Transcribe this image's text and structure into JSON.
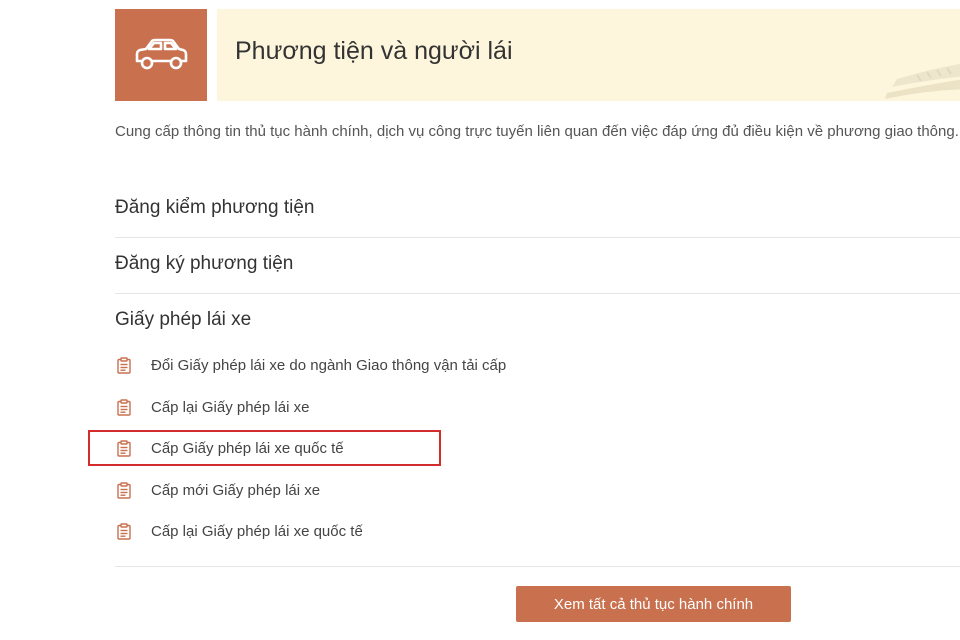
{
  "header": {
    "title": "Phương tiện và người lái",
    "icon": "car-icon",
    "accent_color": "#c9704f",
    "banner_color": "#fdf6dc"
  },
  "description": "Cung cấp thông tin thủ tục hành chính, dịch vụ công trực tuyến liên quan đến việc đáp ứng đủ điều kiện về phương giao thông.",
  "categories": [
    {
      "label": "Đăng kiểm phương tiện"
    },
    {
      "label": "Đăng ký phương tiện"
    },
    {
      "label": "Giấy phép lái xe"
    }
  ],
  "procedures": [
    {
      "label": "Đổi Giấy phép lái xe do ngành Giao thông vận tải cấp",
      "icon": "clipboard-icon"
    },
    {
      "label": "Cấp lại Giấy phép lái xe",
      "icon": "clipboard-icon"
    },
    {
      "label": "Cấp Giấy phép lái xe quốc tế",
      "icon": "clipboard-icon",
      "highlighted": true
    },
    {
      "label": "Cấp mới Giấy phép lái xe",
      "icon": "clipboard-icon"
    },
    {
      "label": "Cấp lại Giấy phép lái xe quốc tế",
      "icon": "clipboard-icon"
    }
  ],
  "highlight_color": "#d22c2c",
  "view_all_button": {
    "label": "Xem tất cả thủ tục hành chính"
  }
}
